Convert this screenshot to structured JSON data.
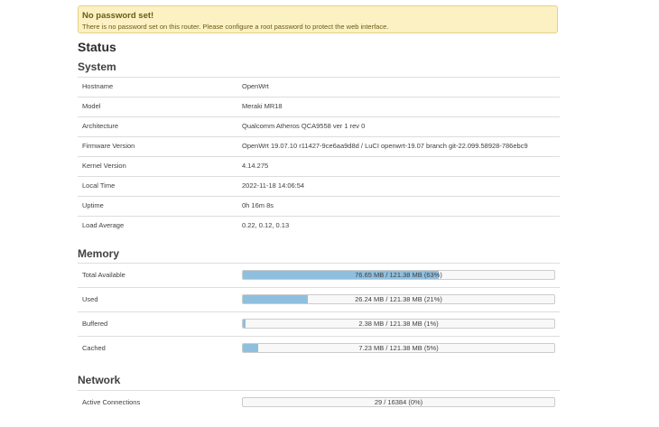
{
  "alert": {
    "title": "No password set!",
    "message": "There is no password set on this router. Please configure a root password to protect the web interface."
  },
  "page_title": "Status",
  "system": {
    "heading": "System",
    "rows": [
      {
        "label": "Hostname",
        "value": "OpenWrt"
      },
      {
        "label": "Model",
        "value": "Meraki MR18"
      },
      {
        "label": "Architecture",
        "value": "Qualcomm Atheros QCA9558 ver 1 rev 0"
      },
      {
        "label": "Firmware Version",
        "value": "OpenWrt 19.07.10 r11427-9ce6aa9d8d / LuCI openwrt-19.07 branch git-22.099.58928-786ebc9"
      },
      {
        "label": "Kernel Version",
        "value": "4.14.275"
      },
      {
        "label": "Local Time",
        "value": "2022-11-18 14:06:54"
      },
      {
        "label": "Uptime",
        "value": "0h 16m 8s"
      },
      {
        "label": "Load Average",
        "value": "0.22, 0.12, 0.13"
      }
    ]
  },
  "memory": {
    "heading": "Memory",
    "rows": [
      {
        "label": "Total Available",
        "text": "76.65 MB / 121.38 MB (63%)",
        "percent": 63
      },
      {
        "label": "Used",
        "text": "26.24 MB / 121.38 MB (21%)",
        "percent": 21
      },
      {
        "label": "Buffered",
        "text": "2.38 MB / 121.38 MB (1%)",
        "percent": 1
      },
      {
        "label": "Cached",
        "text": "7.23 MB / 121.38 MB (5%)",
        "percent": 5
      }
    ]
  },
  "network": {
    "heading": "Network",
    "rows": [
      {
        "label": "Active Connections",
        "text": "29 / 16384 (0%)",
        "percent": 0
      }
    ]
  },
  "colors": {
    "bar_fill": "#8fbfdf",
    "alert_bg": "#fbf1c2"
  }
}
